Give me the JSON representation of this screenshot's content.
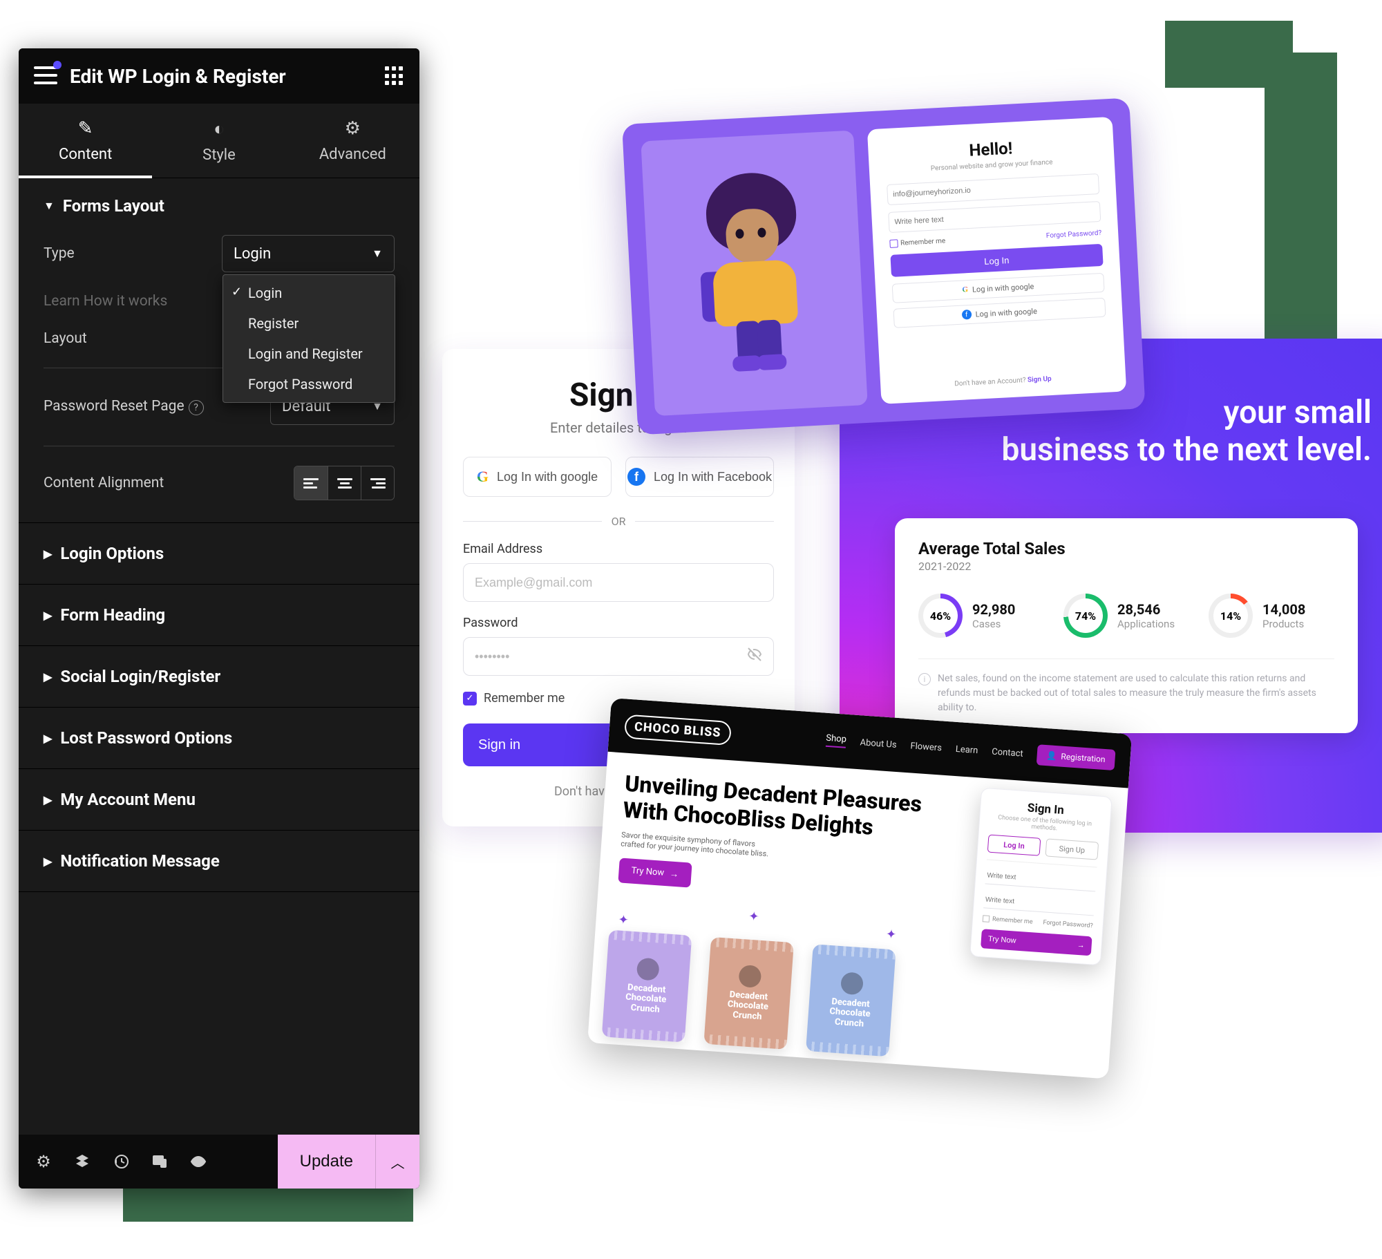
{
  "panel": {
    "title": "Edit WP Login & Register",
    "tabs": {
      "content": "Content",
      "style": "Style",
      "advanced": "Advanced"
    },
    "forms_layout": {
      "heading": "Forms Layout",
      "type_label": "Type",
      "type_value": "Login",
      "dropdown": [
        "Login",
        "Register",
        "Login and Register",
        "Forgot Password"
      ],
      "learn_label": "Learn How it works",
      "layout_label": "Layout",
      "reset_label": "Password Reset Page",
      "reset_value": "Default",
      "align_label": "Content Alignment"
    },
    "sections": {
      "login_options": "Login Options",
      "form_heading": "Form Heading",
      "social": "Social Login/Register",
      "lost_pw": "Lost Password Options",
      "account_menu": "My Account Menu",
      "notif": "Notification Message"
    },
    "footer": {
      "update": "Update"
    }
  },
  "signin": {
    "title": "Sign in",
    "subtitle": "Enter detailes to log In",
    "google": "Log In with google",
    "facebook": "Log In with Facebook",
    "or": "OR",
    "email_label": "Email Address",
    "email_ph": "Example@gmail.com",
    "pw_label": "Password",
    "pw_ph": "••••••••",
    "remember": "Remember me",
    "button": "Sign in",
    "noacct": "Don't have an Account?"
  },
  "hero": {
    "line1": "your small",
    "line2": "business to the next level.",
    "stats": {
      "title": "Average Total Sales",
      "range": "2021-2022",
      "items": [
        {
          "pct": "46%",
          "num": "92,980",
          "lbl": "Cases"
        },
        {
          "pct": "74%",
          "num": "28,546",
          "lbl": "Applications"
        },
        {
          "pct": "14%",
          "num": "14,008",
          "lbl": "Products"
        }
      ],
      "note": "Net sales, found on the income statement are used to calculate this ration returns and refunds must be backed out of total sales to measure the truly measure the firm's assets ability to."
    }
  },
  "hello": {
    "title": "Hello!",
    "sub": "Personal website and grow your finance",
    "email_ph": "info@journeyhorizon.io",
    "pw_ph": "Write here text",
    "remember": "Remember me",
    "forgot": "Forgot Password?",
    "login": "Log In",
    "google": "Log in with google",
    "fb": "Log in with google",
    "foot_pre": "Don't have an Account? ",
    "foot_link": "Sign Up"
  },
  "choco": {
    "logo": "CHOCO BLISS",
    "nav": [
      "Shop",
      "About Us",
      "Flowers",
      "Learn",
      "Contact"
    ],
    "reg": "Registration",
    "h1a": "Unveiling Decadent Pleasures",
    "h1b": "With ChocoBliss Delights",
    "sub": "Savor the exquisite symphony of flavors crafted for your journey into chocolate bliss.",
    "try": "Try Now",
    "packet": "Decadent Chocolate Crunch",
    "signin": {
      "title": "Sign In",
      "sub": "Choose one of the following log in methods.",
      "tab_login": "Log In",
      "tab_signup": "Sign Up",
      "email_ph": "Write text",
      "pw_ph": "Write text",
      "remember": "Remember me",
      "forgot": "Forgot Password?",
      "btn": "Try Now"
    }
  }
}
